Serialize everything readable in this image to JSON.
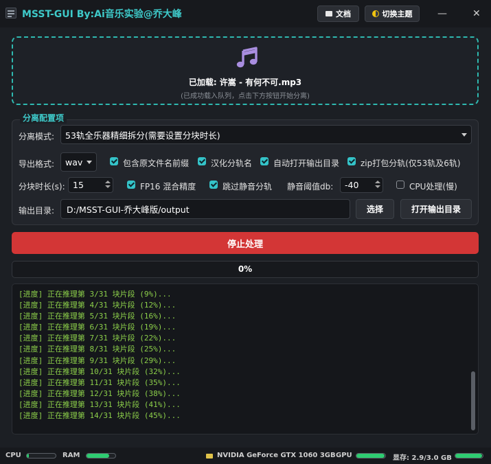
{
  "title_bar": {
    "app_title": "MSST-GUI By:Ai音乐实验@乔大峰",
    "docs_label": "文档",
    "theme_label": "切换主题",
    "minimize_glyph": "—",
    "close_glyph": "✕"
  },
  "drop_zone": {
    "icon": "music-note-icon",
    "loaded_text": "已加载: 许嵩 - 有何不可.mp3",
    "hint": "(已成功载入队列，点击下方按钮开始分离)",
    "border_color": "#2fb9b0"
  },
  "config": {
    "group_title": "分离配置项",
    "mode_label": "分离模式:",
    "mode_value": "53轨全乐器精细拆分(需要设置分块时长)",
    "format_label": "导出格式:",
    "format_value": "wav",
    "options": [
      {
        "label": "包含原文件名前缀",
        "checked": true
      },
      {
        "label": "汉化分轨名",
        "checked": true
      },
      {
        "label": "自动打开输出目录",
        "checked": true
      },
      {
        "label": "zip打包分轨(仅53轨及6轨)",
        "checked": true
      }
    ],
    "chunk_label": "分块时长(s):",
    "chunk_value": "15",
    "fp16": {
      "label": "FP16 混合精度",
      "checked": true
    },
    "skip_silent": {
      "label": "跳过静音分轨",
      "checked": true
    },
    "threshold_label": "静音阈值db:",
    "threshold_value": "-40",
    "cpu": {
      "label": "CPU处理(慢)",
      "checked": false
    },
    "output_label": "输出目录:",
    "output_value": "D:/MSST-GUI-乔大峰版/output",
    "select_label": "选择",
    "open_output_label": "打开输出目录"
  },
  "actions": {
    "stop_label": "停止处理",
    "stop_color": "#d33636"
  },
  "progress": {
    "value": 0,
    "text": "0%"
  },
  "log": {
    "lines": [
      "[进度] 正在推理第 3/31 块片段 (9%)...",
      "[进度] 正在推理第 4/31 块片段 (12%)...",
      "[进度] 正在推理第 5/31 块片段 (16%)...",
      "[进度] 正在推理第 6/31 块片段 (19%)...",
      "[进度] 正在推理第 7/31 块片段 (22%)...",
      "[进度] 正在推理第 8/31 块片段 (25%)...",
      "[进度] 正在推理第 9/31 块片段 (29%)...",
      "[进度] 正在推理第 10/31 块片段 (32%)...",
      "[进度] 正在推理第 11/31 块片段 (35%)...",
      "[进度] 正在推理第 12/31 块片段 (38%)...",
      "[进度] 正在推理第 13/31 块片段 (41%)...",
      "[进度] 正在推理第 14/31 块片段 (45%)..."
    ],
    "text_color": "#8ccf4a"
  },
  "status": {
    "cpu_label": "CPU",
    "cpu_usage": 0.08,
    "ram_label": "RAM",
    "ram_usage": 0.78,
    "gpu_name": "NVIDIA GeForce GTX 1060 3GB",
    "gpu_label": "GPU",
    "gpu_usage": 0.97,
    "vram_text": "显存: 2.9/3.0 GB",
    "vram_usage": 0.97,
    "bar_color": "#2ecc71"
  }
}
